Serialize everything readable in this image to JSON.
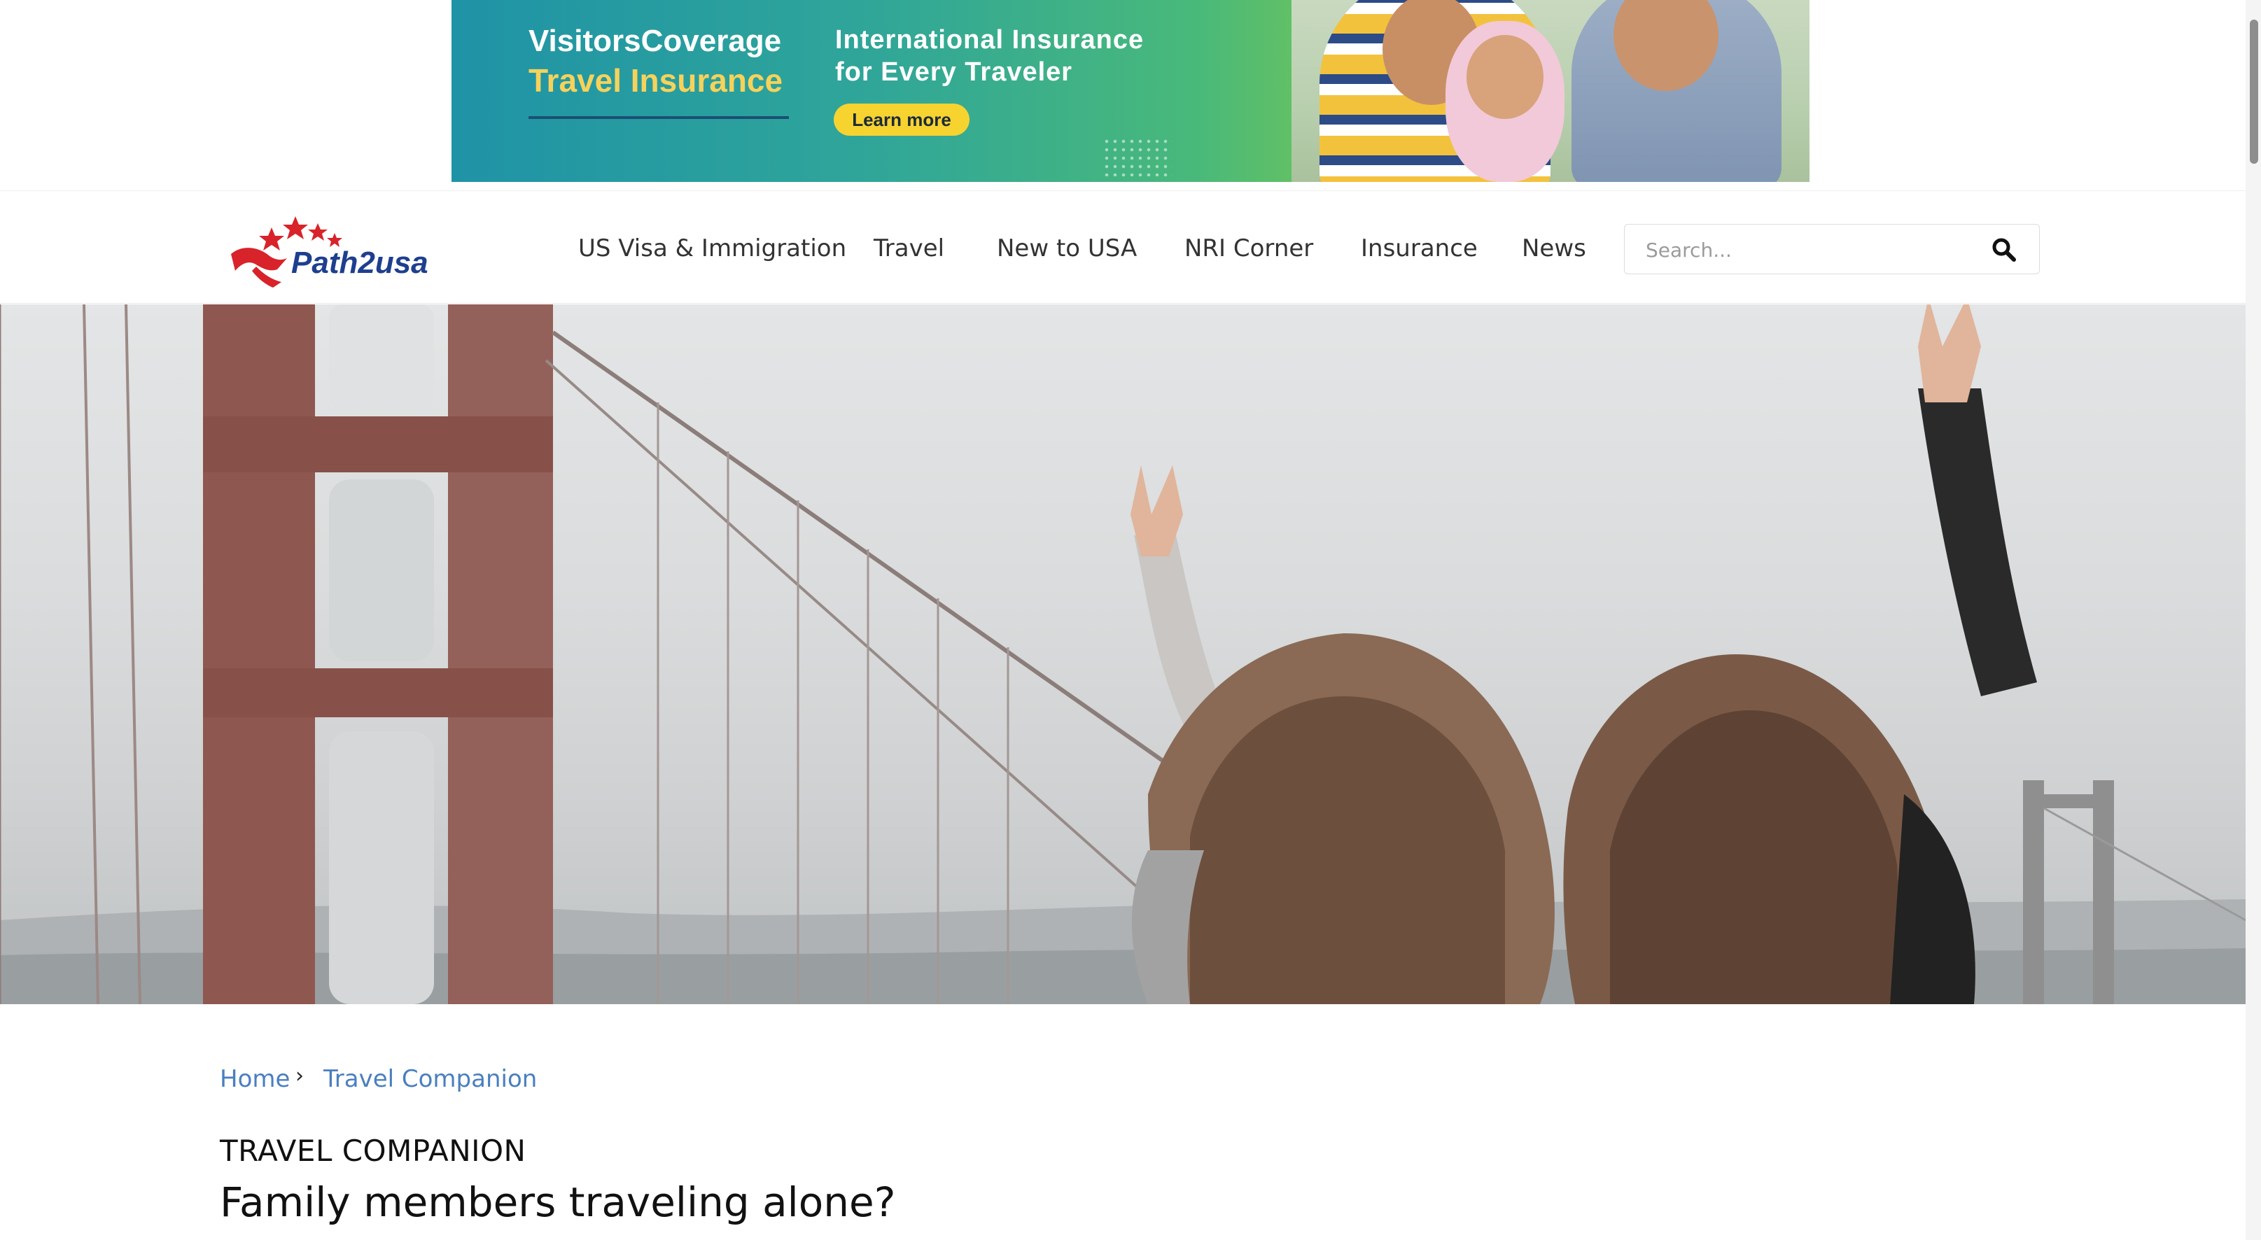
{
  "ad": {
    "brand_line1": "VisitorsCoverage",
    "brand_line2": "Travel Insurance",
    "headline_line1": "International Insurance",
    "headline_line2": "for Every Traveler",
    "cta_label": "Learn more"
  },
  "logo": {
    "text": "Path2usa",
    "icon": "stars-runner-logo",
    "colors": {
      "stars": "#d8232a",
      "text": "#1e3f8f"
    }
  },
  "nav": {
    "items": [
      {
        "label": "US Visa & Immigration"
      },
      {
        "label": "Travel"
      },
      {
        "label": "New to USA"
      },
      {
        "label": "NRI Corner"
      },
      {
        "label": "Insurance"
      },
      {
        "label": "News"
      }
    ]
  },
  "search": {
    "placeholder": "Search...",
    "value": "",
    "icon": "search-icon"
  },
  "breadcrumb": {
    "items": [
      {
        "label": "Home"
      },
      {
        "label": "Travel Companion"
      }
    ],
    "separator_icon": "chevron-right-icon"
  },
  "article": {
    "category": "TRAVEL COMPANION",
    "title": "Family members traveling alone?"
  },
  "colors": {
    "link": "#4a7fc0",
    "ad_cta": "#f7d330",
    "ad_brand_accent": "#f6d25b"
  }
}
